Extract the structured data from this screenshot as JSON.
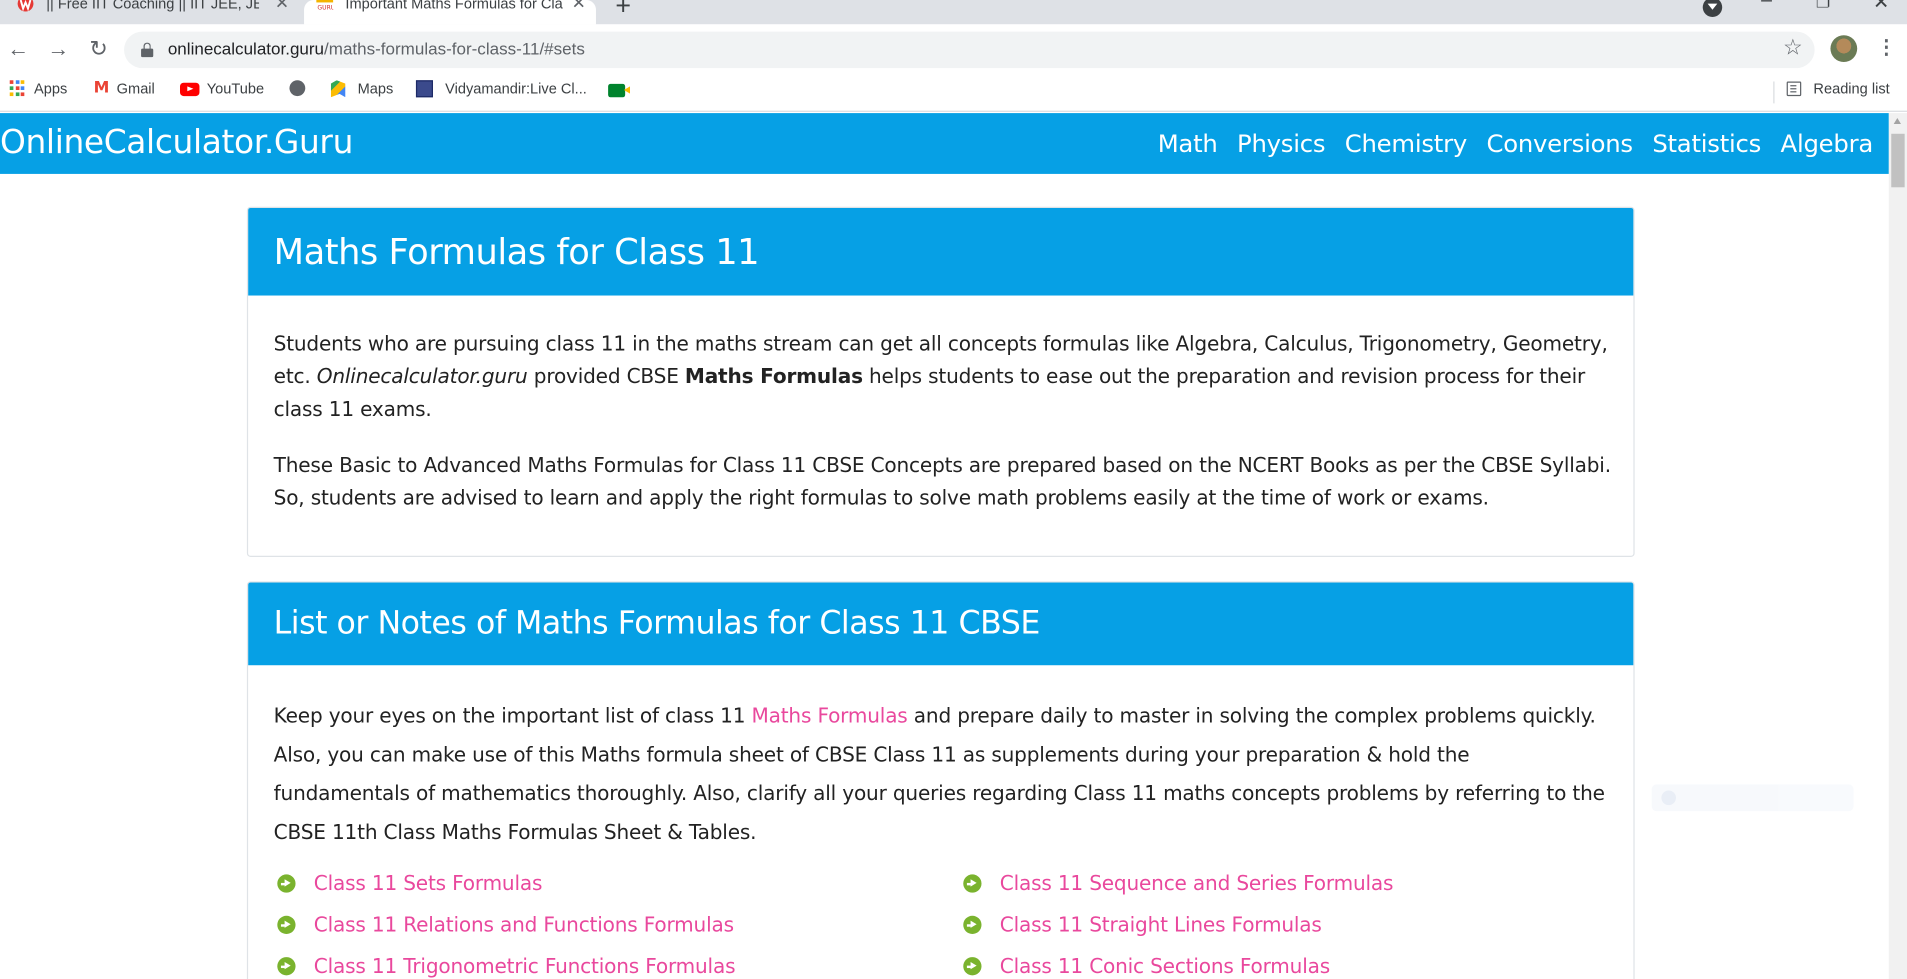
{
  "browser": {
    "tabs": [
      {
        "title": "|| Free IIT Coaching || IIT JEE, JEE M",
        "active": false
      },
      {
        "title": "Important Maths Formulas for Cla",
        "active": true
      }
    ],
    "url_host": "onlinecalculator.guru",
    "url_path": "/maths-formulas-for-class-11/#sets",
    "bookmarks": [
      "Apps",
      "Gmail",
      "YouTube",
      "",
      "Maps",
      "Vidyamandir:Live Cl...",
      ""
    ],
    "reading_list": "Reading list"
  },
  "site": {
    "brand": "OnlineCalculator.Guru",
    "nav": [
      "Math",
      "Physics",
      "Chemistry",
      "Conversions",
      "Statistics",
      "Algebra"
    ],
    "brand_color": "#06a0e5",
    "link_color": "#e9489d"
  },
  "intro": {
    "title": "Maths Formulas for Class 11",
    "p1_a": "Students who are pursuing class 11 in the maths stream can get all concepts formulas like Algebra, Calculus, Trigonometry, Geometry, etc. ",
    "p1_site": "Onlinecalculator.guru",
    "p1_b": " provided CBSE ",
    "p1_bold": "Maths Formulas",
    "p1_c": " helps students to ease out the preparation and revision process for their class 11 exams.",
    "p2": "These Basic to Advanced Maths Formulas for Class 11 CBSE Concepts are prepared based on the NCERT Books as per the CBSE Syllabi. So, students are advised to learn and apply the right formulas to solve math problems easily at the time of work or exams."
  },
  "list": {
    "title": "List or Notes of Maths Formulas for Class 11 CBSE",
    "p_a": "Keep your eyes on the important list of class 11 ",
    "p_link": "Maths Formulas",
    "p_b": " and prepare daily to master in solving the complex problems quickly. Also, you can make use of this Maths formula sheet of CBSE Class 11 as supplements during your preparation & hold the fundamentals of mathematics thoroughly. Also, clarify all your queries regarding Class 11 maths concepts problems by referring to the CBSE 11th Class Maths Formulas Sheet & Tables.",
    "links_left": [
      "Class 11 Sets Formulas",
      "Class 11 Relations and Functions Formulas",
      "Class 11 Trigonometric Functions Formulas"
    ],
    "links_right": [
      "Class 11 Sequence and Series Formulas",
      "Class 11 Straight Lines Formulas",
      "Class 11 Conic Sections Formulas"
    ]
  }
}
